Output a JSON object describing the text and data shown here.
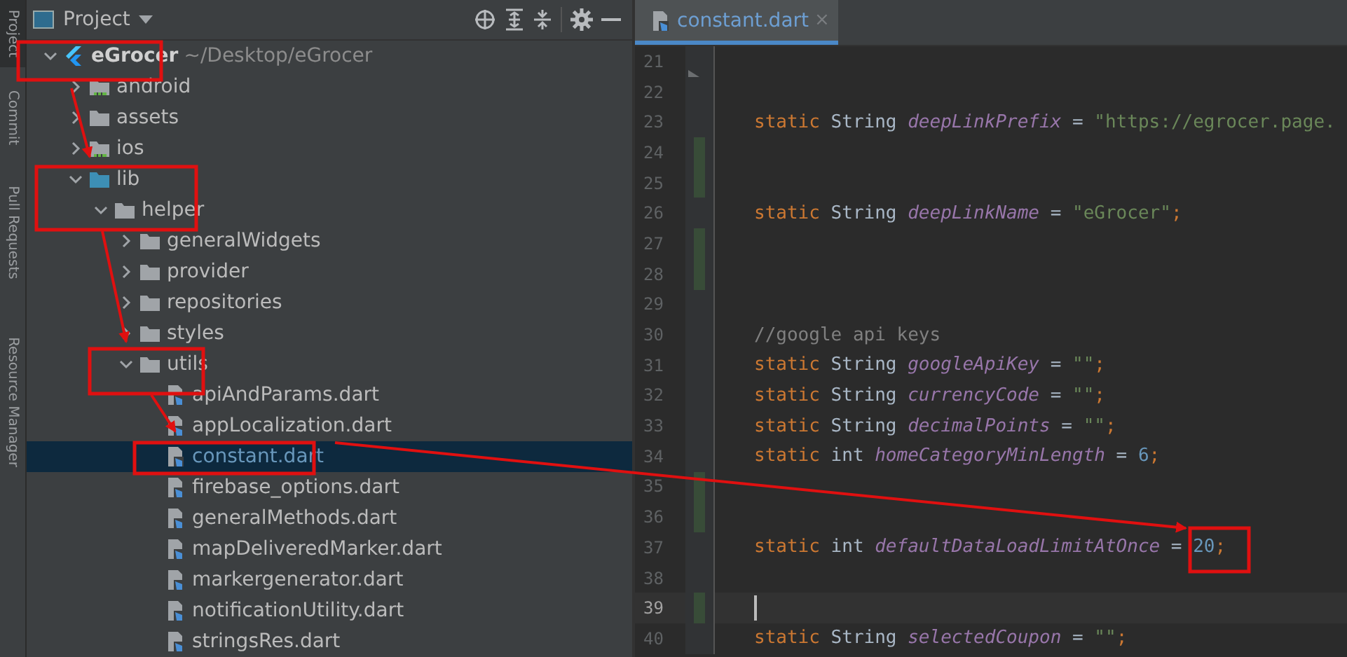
{
  "side_tabs": [
    {
      "label": "Project"
    },
    {
      "label": "Commit"
    },
    {
      "label": "Pull Requests"
    },
    {
      "label": "Resource Manager"
    }
  ],
  "project_panel": {
    "title": "Project",
    "tree": [
      {
        "label": "eGrocer",
        "path": "~/Desktop/eGrocer",
        "kind": "project",
        "expanded": true,
        "selected": false,
        "children": [
          {
            "label": "android",
            "kind": "module-folder",
            "expanded": false,
            "selected": false
          },
          {
            "label": "assets",
            "kind": "folder",
            "expanded": false,
            "selected": false
          },
          {
            "label": "ios",
            "kind": "module-folder",
            "expanded": false,
            "selected": false
          },
          {
            "label": "lib",
            "kind": "source-folder",
            "expanded": true,
            "selected": false,
            "children": [
              {
                "label": "helper",
                "kind": "folder",
                "expanded": true,
                "selected": false,
                "children": [
                  {
                    "label": "generalWidgets",
                    "kind": "folder",
                    "expanded": false,
                    "selected": false
                  },
                  {
                    "label": "provider",
                    "kind": "folder",
                    "expanded": false,
                    "selected": false
                  },
                  {
                    "label": "repositories",
                    "kind": "folder",
                    "expanded": false,
                    "selected": false
                  },
                  {
                    "label": "styles",
                    "kind": "folder",
                    "expanded": false,
                    "selected": false
                  },
                  {
                    "label": "utils",
                    "kind": "folder",
                    "expanded": true,
                    "selected": false,
                    "children": [
                      {
                        "label": "apiAndParams.dart",
                        "kind": "dart-file",
                        "selected": false
                      },
                      {
                        "label": "appLocalization.dart",
                        "kind": "dart-file",
                        "selected": false
                      },
                      {
                        "label": "constant.dart",
                        "kind": "dart-file",
                        "selected": true
                      },
                      {
                        "label": "firebase_options.dart",
                        "kind": "dart-file",
                        "selected": false
                      },
                      {
                        "label": "generalMethods.dart",
                        "kind": "dart-file",
                        "selected": false
                      },
                      {
                        "label": "mapDeliveredMarker.dart",
                        "kind": "dart-file",
                        "selected": false
                      },
                      {
                        "label": "markergenerator.dart",
                        "kind": "dart-file",
                        "selected": false
                      },
                      {
                        "label": "notificationUtility.dart",
                        "kind": "dart-file",
                        "selected": false
                      },
                      {
                        "label": "stringsRes.dart",
                        "kind": "dart-file",
                        "selected": false
                      }
                    ]
                  }
                ]
              }
            ]
          }
        ]
      }
    ]
  },
  "editor": {
    "tabs": [
      {
        "label": "constant.dart",
        "close": "×",
        "selected": true
      }
    ],
    "lines": [
      {
        "number": "21",
        "changed": false,
        "current": false
      },
      {
        "number": "22",
        "changed": false,
        "current": false
      },
      {
        "number": "23",
        "changed": false,
        "current": false,
        "tokens": [
          {
            "kind": "keyword",
            "text": "static "
          },
          {
            "kind": "type",
            "text": "String "
          },
          {
            "kind": "field",
            "text": "deepLinkPrefix"
          },
          {
            "kind": "plain",
            "text": " = "
          },
          {
            "kind": "string",
            "text": "\"https://egrocer.page."
          }
        ]
      },
      {
        "number": "24",
        "changed": true,
        "current": false
      },
      {
        "number": "25",
        "changed": true,
        "current": false
      },
      {
        "number": "26",
        "changed": false,
        "current": false,
        "tokens": [
          {
            "kind": "keyword",
            "text": "static "
          },
          {
            "kind": "type",
            "text": "String "
          },
          {
            "kind": "field",
            "text": "deepLinkName"
          },
          {
            "kind": "plain",
            "text": " = "
          },
          {
            "kind": "string",
            "text": "\"eGrocer\""
          },
          {
            "kind": "keyword",
            "text": ";"
          }
        ]
      },
      {
        "number": "27",
        "changed": true,
        "current": false
      },
      {
        "number": "28",
        "changed": true,
        "current": false
      },
      {
        "number": "29",
        "changed": false,
        "current": false
      },
      {
        "number": "30",
        "changed": false,
        "current": false,
        "tokens": [
          {
            "kind": "comment",
            "text": "//google api keys"
          }
        ]
      },
      {
        "number": "31",
        "changed": false,
        "current": false,
        "tokens": [
          {
            "kind": "keyword",
            "text": "static "
          },
          {
            "kind": "type",
            "text": "String "
          },
          {
            "kind": "field",
            "text": "googleApiKey"
          },
          {
            "kind": "plain",
            "text": " = "
          },
          {
            "kind": "string",
            "text": "\"\""
          },
          {
            "kind": "keyword",
            "text": ";"
          }
        ]
      },
      {
        "number": "32",
        "changed": false,
        "current": false,
        "tokens": [
          {
            "kind": "keyword",
            "text": "static "
          },
          {
            "kind": "type",
            "text": "String "
          },
          {
            "kind": "field",
            "text": "currencyCode"
          },
          {
            "kind": "plain",
            "text": " = "
          },
          {
            "kind": "string",
            "text": "\"\""
          },
          {
            "kind": "keyword",
            "text": ";"
          }
        ]
      },
      {
        "number": "33",
        "changed": false,
        "current": false,
        "tokens": [
          {
            "kind": "keyword",
            "text": "static "
          },
          {
            "kind": "type",
            "text": "String "
          },
          {
            "kind": "field",
            "text": "decimalPoints"
          },
          {
            "kind": "plain",
            "text": " = "
          },
          {
            "kind": "string",
            "text": "\"\""
          },
          {
            "kind": "keyword",
            "text": ";"
          }
        ]
      },
      {
        "number": "34",
        "changed": false,
        "current": false,
        "tokens": [
          {
            "kind": "keyword",
            "text": "static "
          },
          {
            "kind": "type",
            "text": "int "
          },
          {
            "kind": "field",
            "text": "homeCategoryMinLength"
          },
          {
            "kind": "plain",
            "text": " = "
          },
          {
            "kind": "number",
            "text": "6"
          },
          {
            "kind": "keyword",
            "text": ";"
          }
        ]
      },
      {
        "number": "35",
        "changed": true,
        "current": false
      },
      {
        "number": "36",
        "changed": true,
        "current": false
      },
      {
        "number": "37",
        "changed": false,
        "current": false,
        "tokens": [
          {
            "kind": "keyword",
            "text": "static "
          },
          {
            "kind": "type",
            "text": "int "
          },
          {
            "kind": "field",
            "text": "defaultDataLoadLimitAtOnce"
          },
          {
            "kind": "plain",
            "text": " = "
          },
          {
            "kind": "number",
            "text": "20"
          },
          {
            "kind": "keyword",
            "text": ";"
          }
        ]
      },
      {
        "number": "38",
        "changed": false,
        "current": false
      },
      {
        "number": "39",
        "changed": true,
        "current": true
      },
      {
        "number": "40",
        "changed": false,
        "current": false,
        "tokens": [
          {
            "kind": "keyword",
            "text": "static "
          },
          {
            "kind": "type",
            "text": "String "
          },
          {
            "kind": "field",
            "text": "selectedCoupon"
          },
          {
            "kind": "plain",
            "text": " = "
          },
          {
            "kind": "string",
            "text": "\"\""
          },
          {
            "kind": "keyword",
            "text": ";"
          }
        ]
      }
    ]
  }
}
